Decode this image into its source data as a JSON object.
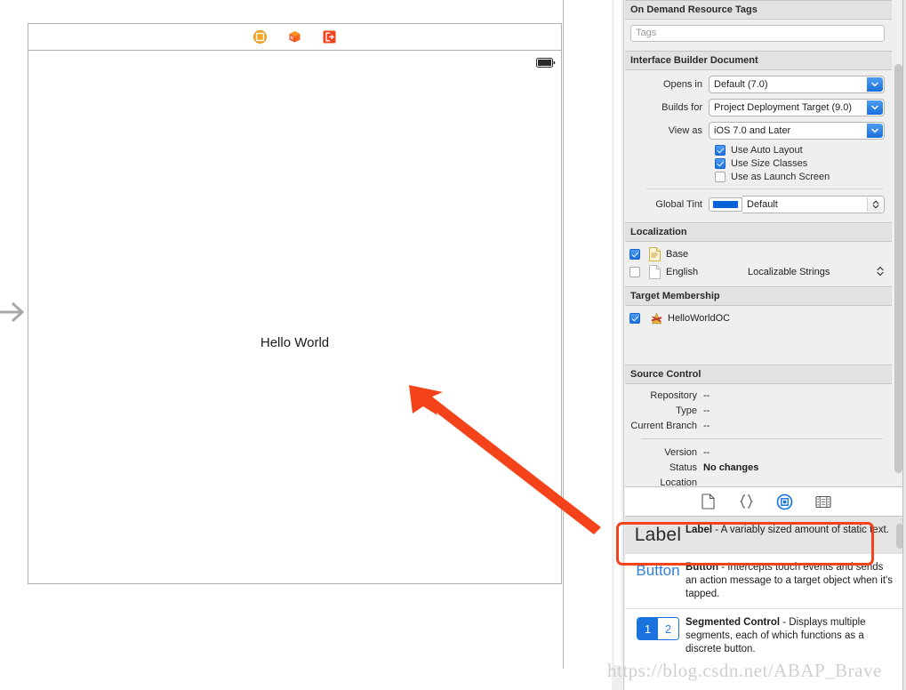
{
  "canvas": {
    "scene_dock_icons": [
      {
        "name": "view-controller-icon",
        "title": "View Controller"
      },
      {
        "name": "first-responder-icon",
        "title": "First Responder"
      },
      {
        "name": "exit-icon",
        "title": "Exit"
      }
    ],
    "entry_arrow_name": "storyboard-entry-point-arrow",
    "status_bar_battery": "battery-icon",
    "label_text": "Hello World",
    "annotation": {
      "name": "red-annotation-arrow",
      "color": "#f4421a"
    }
  },
  "inspector": {
    "on_demand": {
      "header": "On Demand Resource Tags",
      "tags_placeholder": "Tags",
      "tags_value": ""
    },
    "ib_document": {
      "header": "Interface Builder Document",
      "opens_in_label": "Opens in",
      "opens_in_value": "Default (7.0)",
      "builds_for_label": "Builds for",
      "builds_for_value": "Project Deployment Target (9.0)",
      "view_as_label": "View as",
      "view_as_value": "iOS 7.0 and Later",
      "checkboxes": [
        {
          "label": "Use Auto Layout",
          "checked": true
        },
        {
          "label": "Use Size Classes",
          "checked": true
        },
        {
          "label": "Use as Launch Screen",
          "checked": false
        }
      ],
      "global_tint_label": "Global Tint",
      "global_tint_value": "Default",
      "global_tint_color": "#0a62d8"
    },
    "localization": {
      "header": "Localization",
      "rows": [
        {
          "checked": true,
          "name": "Base",
          "kind": "",
          "icon": "document-filled-icon"
        },
        {
          "checked": false,
          "name": "English",
          "kind": "Localizable Strings",
          "icon": "document-blank-icon"
        }
      ]
    },
    "target_membership": {
      "header": "Target Membership",
      "rows": [
        {
          "checked": true,
          "name": "HelloWorldOC",
          "icon": "xcode-target-icon"
        }
      ]
    },
    "source_control": {
      "header": "Source Control",
      "rows": [
        {
          "label": "Repository",
          "value": "--",
          "bold": false
        },
        {
          "label": "Type",
          "value": "--",
          "bold": false
        },
        {
          "label": "Current Branch",
          "value": "--",
          "bold": false
        }
      ],
      "rows2": [
        {
          "label": "Version",
          "value": "--",
          "bold": false
        },
        {
          "label": "Status",
          "value": "No changes",
          "bold": true
        },
        {
          "label": "Location",
          "value": "",
          "bold": false
        }
      ]
    }
  },
  "library": {
    "tabs": [
      {
        "name": "file-template-library-tab",
        "selected": false
      },
      {
        "name": "code-snippet-library-tab",
        "selected": false
      },
      {
        "name": "object-library-tab",
        "selected": true
      },
      {
        "name": "media-library-tab",
        "selected": false
      }
    ],
    "selected_accent": "#f4421a",
    "items": [
      {
        "thumb_kind": "label",
        "thumb_text": "Label",
        "title": "Label",
        "description": " - A variably sized amount of static text.",
        "selected": true
      },
      {
        "thumb_kind": "button",
        "thumb_text": "Button",
        "title": "Button",
        "description": " - Intercepts touch events and sends an action message to a target object when it's tapped.",
        "selected": false
      },
      {
        "thumb_kind": "segmented",
        "thumb_text": "1 2",
        "title": "Segmented Control",
        "description": " - Displays multiple segments, each of which functions as a discrete button.",
        "selected": false
      }
    ]
  },
  "watermark": "https://blog.csdn.net/ABAP_Brave"
}
